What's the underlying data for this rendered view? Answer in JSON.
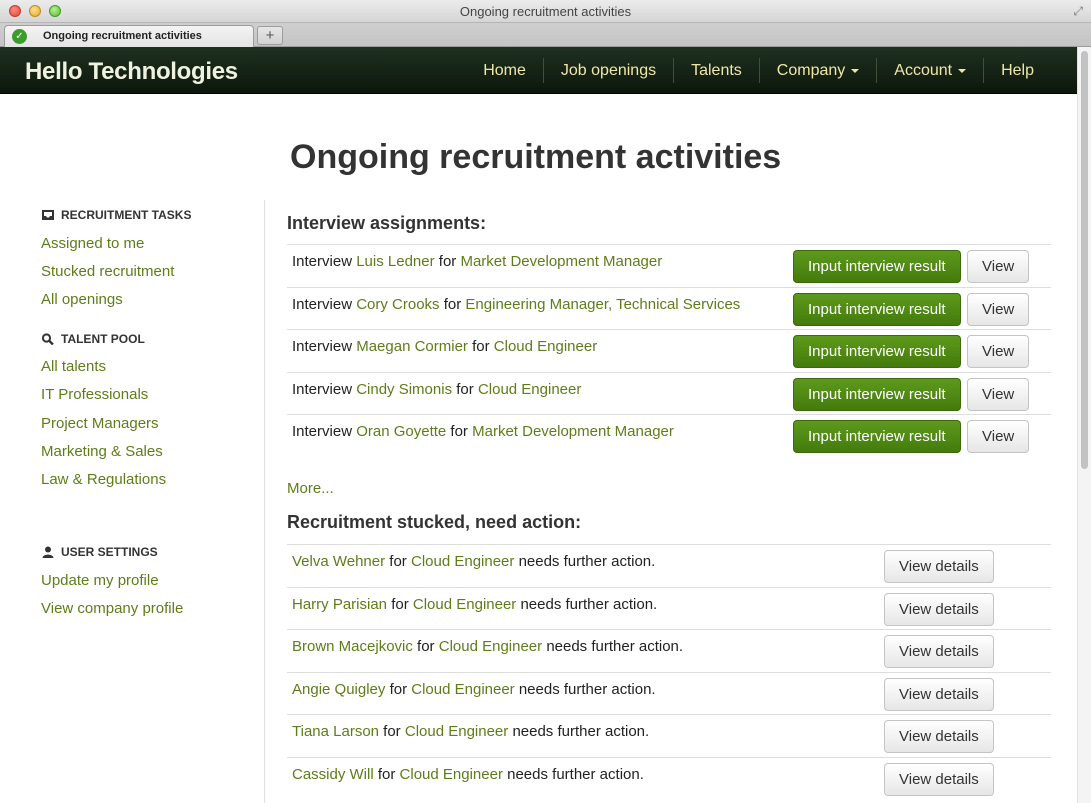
{
  "window": {
    "title": "Ongoing recruitment activities"
  },
  "tab": {
    "label": "Ongoing recruitment activities",
    "new_tab": "+"
  },
  "navbar": {
    "brand": "Hello Technologies",
    "items": [
      {
        "label": "Home",
        "dropdown": false
      },
      {
        "label": "Job openings",
        "dropdown": false
      },
      {
        "label": "Talents",
        "dropdown": false
      },
      {
        "label": "Company",
        "dropdown": true
      },
      {
        "label": "Account",
        "dropdown": true
      },
      {
        "label": "Help",
        "dropdown": false
      }
    ]
  },
  "page": {
    "title": "Ongoing recruitment activities"
  },
  "sidebar": {
    "recruitment_tasks": {
      "heading": "RECRUITMENT TASKS",
      "icon": "inbox-icon",
      "links": [
        "Assigned to me",
        "Stucked recruitment",
        "All openings"
      ]
    },
    "talent_pool": {
      "heading": "TALENT POOL",
      "icon": "search-icon",
      "links": [
        "All talents",
        "IT Professionals",
        "Project Managers",
        "Marketing & Sales",
        "Law & Regulations"
      ]
    },
    "user_settings": {
      "heading": "USER SETTINGS",
      "icon": "user-icon",
      "links": [
        "Update my profile",
        "View company profile"
      ]
    }
  },
  "interviews": {
    "heading": "Interview assignments:",
    "prefix": "Interview",
    "joiner": "for",
    "input_label": "Input interview result",
    "view_label": "View",
    "rows": [
      {
        "name": "Luis Ledner",
        "position": "Market Development Manager"
      },
      {
        "name": "Cory Crooks",
        "position": "Engineering Manager, Technical Services"
      },
      {
        "name": "Maegan Cormier",
        "position": "Cloud Engineer"
      },
      {
        "name": "Cindy Simonis",
        "position": "Cloud Engineer"
      },
      {
        "name": "Oran Goyette",
        "position": "Market Development Manager"
      }
    ],
    "more": "More..."
  },
  "stucked": {
    "heading": "Recruitment stucked, need action:",
    "joiner": "for",
    "suffix": "needs further action.",
    "button_label": "View details",
    "rows": [
      {
        "name": "Velva Wehner",
        "position": "Cloud Engineer"
      },
      {
        "name": "Harry Parisian",
        "position": "Cloud Engineer"
      },
      {
        "name": "Brown Macejkovic",
        "position": "Cloud Engineer"
      },
      {
        "name": "Angie Quigley",
        "position": "Cloud Engineer"
      },
      {
        "name": "Tiana Larson",
        "position": "Cloud Engineer"
      },
      {
        "name": "Cassidy Will",
        "position": "Cloud Engineer"
      }
    ]
  },
  "colors": {
    "accent_link": "#5e7d19",
    "nav_text": "#f0e7a6",
    "button_green": "#4f8a15",
    "navbar_bg": "#142314"
  }
}
